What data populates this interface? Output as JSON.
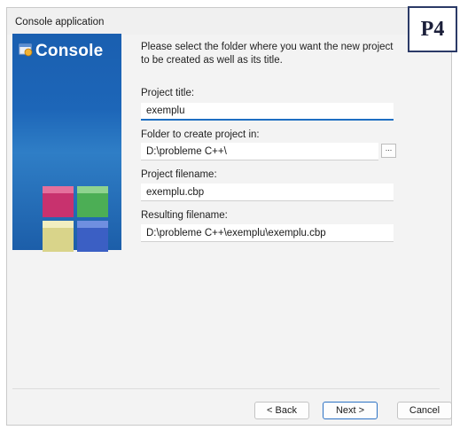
{
  "window": {
    "title": "Console application"
  },
  "badge": "P4",
  "banner": {
    "title": "Console"
  },
  "intro_text": "Please select the folder where you want the new project to be created as well as its title.",
  "fields": {
    "project_title": {
      "label": "Project title:",
      "value": "exemplu"
    },
    "folder": {
      "label": "Folder to create project in:",
      "value": "D:\\probleme C++\\",
      "browse_label": "..."
    },
    "project_filename": {
      "label": "Project filename:",
      "value": "exemplu.cbp"
    },
    "resulting_filename": {
      "label": "Resulting filename:",
      "value": "D:\\probleme C++\\exemplu\\exemplu.cbp"
    }
  },
  "buttons": {
    "back": "< Back",
    "next": "Next >",
    "cancel": "Cancel"
  },
  "colors": {
    "banner_blue": "#1a5fb0",
    "focus_blue": "#1e6fc2"
  }
}
